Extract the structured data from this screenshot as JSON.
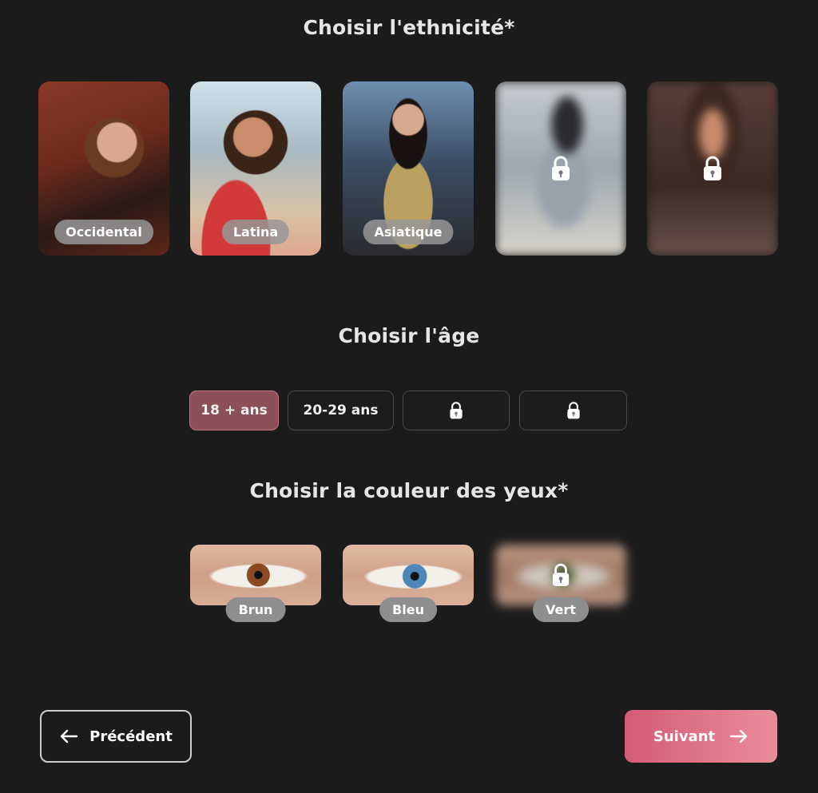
{
  "ethnicity": {
    "title": "Choisir l'ethnicité*",
    "options": [
      {
        "label": "Occidental",
        "locked": false
      },
      {
        "label": "Latina",
        "locked": false
      },
      {
        "label": "Asiatique",
        "locked": false
      },
      {
        "label": "",
        "locked": true
      },
      {
        "label": "",
        "locked": true
      }
    ]
  },
  "age": {
    "title": "Choisir l'âge",
    "options": [
      {
        "label": "18 + ans",
        "selected": true,
        "locked": false
      },
      {
        "label": "20-29 ans",
        "selected": false,
        "locked": false
      },
      {
        "label": "",
        "selected": false,
        "locked": true
      },
      {
        "label": "",
        "selected": false,
        "locked": true
      }
    ]
  },
  "eyes": {
    "title": "Choisir la couleur des yeux*",
    "options": [
      {
        "label": "Brun",
        "locked": false
      },
      {
        "label": "Bleu",
        "locked": false
      },
      {
        "label": "Vert",
        "locked": true
      }
    ]
  },
  "nav": {
    "prev_label": "Précédent",
    "next_label": "Suivant"
  },
  "colors": {
    "background": "#1b1b1c",
    "accent": "#e07486",
    "selected_chip": "#8c5058"
  },
  "icons": {
    "lock": "lock-icon",
    "prev": "arrow-left-icon",
    "next": "arrow-right-icon"
  }
}
